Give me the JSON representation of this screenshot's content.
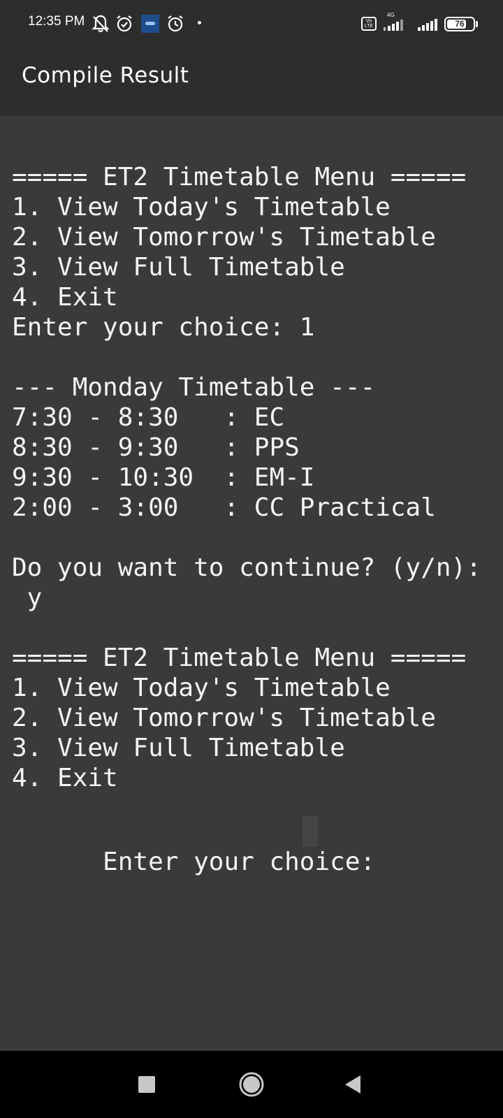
{
  "status_bar": {
    "time": "12:35 PM",
    "icons": [
      "muted-bell-icon",
      "alarm-icon",
      "app-badge-icon",
      "alarm-icon",
      "dot-icon",
      "volte-icon",
      "signal-4g-icon",
      "signal-icon",
      "battery-icon"
    ],
    "volte_label": "Vo LTE",
    "network_type": "4G",
    "battery_level": "76"
  },
  "app_bar": {
    "title": "Compile Result"
  },
  "console": {
    "output_lines": [
      "===== ET2 Timetable Menu =====",
      "1. View Today's Timetable",
      "2. View Tomorrow's Timetable",
      "3. View Full Timetable",
      "4. Exit",
      "Enter your choice: 1",
      "",
      "--- Monday Timetable ---",
      "7:30 - 8:30   : EC",
      "8:30 - 9:30   : PPS",
      "9:30 - 10:30  : EM-I",
      "2:00 - 3:00   : CC Practical",
      "",
      "Do you want to continue? (y/n):",
      " y",
      "",
      "===== ET2 Timetable Menu =====",
      "1. View Today's Timetable",
      "2. View Tomorrow's Timetable",
      "3. View Full Timetable",
      "4. Exit"
    ],
    "input_prompt": "Enter your choice: ",
    "input_value": ""
  },
  "nav_bar": {
    "buttons": [
      "recents-square-icon",
      "home-circle-icon",
      "back-triangle-icon"
    ]
  },
  "colors": {
    "background": "#3a3a3a",
    "bar": "#2d2d2d",
    "text": "#f4f4f4",
    "nav": "#000000"
  }
}
